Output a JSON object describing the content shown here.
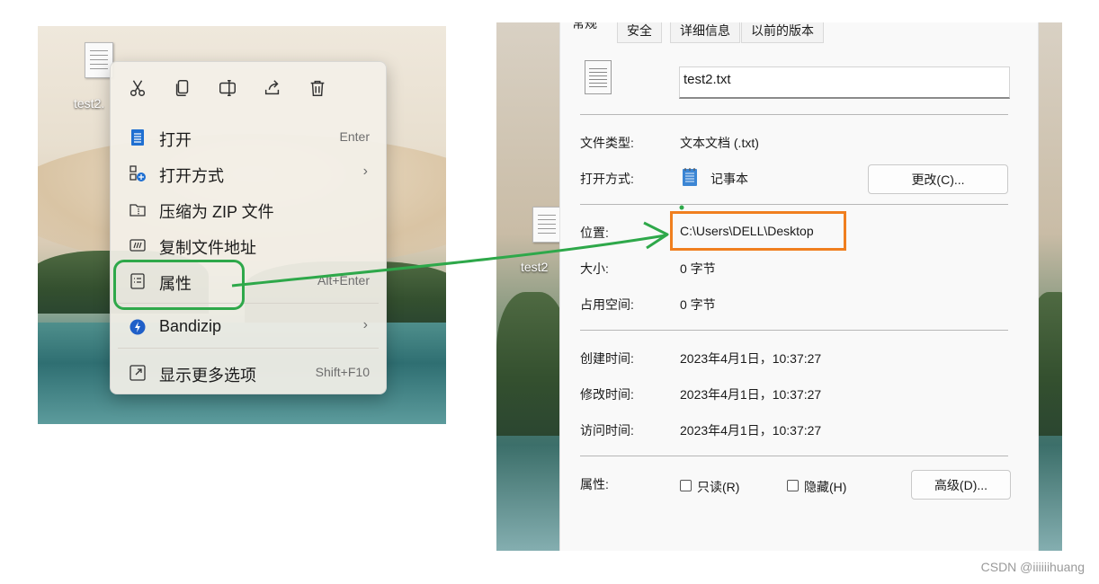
{
  "desktop": {
    "file_label": "test2.",
    "file_label_right": "test2"
  },
  "context_menu": {
    "toolbar": [
      {
        "name": "cut-icon"
      },
      {
        "name": "copy-icon"
      },
      {
        "name": "rename-icon"
      },
      {
        "name": "share-icon"
      },
      {
        "name": "delete-icon"
      }
    ],
    "items": [
      {
        "label": "打开",
        "shortcut": "Enter",
        "icon": "notepad-icon"
      },
      {
        "label": "打开方式",
        "shortcut": "",
        "icon": "open-with-icon",
        "submenu": true
      },
      {
        "label": "压缩为 ZIP 文件",
        "shortcut": "",
        "icon": "zip-icon"
      },
      {
        "label": "复制文件地址",
        "shortcut": "",
        "icon": "copy-path-icon"
      },
      {
        "label": "属性",
        "shortcut": "Alt+Enter",
        "icon": "properties-icon"
      },
      {
        "label": "Bandizip",
        "shortcut": "",
        "icon": "bandizip-icon",
        "submenu": true
      },
      {
        "label": "显示更多选项",
        "shortcut": "Shift+F10",
        "icon": "more-options-icon"
      }
    ],
    "arrow_glyph": "›"
  },
  "properties": {
    "tabs": [
      "常规",
      "安全",
      "详细信息",
      "以前的版本"
    ],
    "file_name": "test2.txt",
    "type_label": "文件类型:",
    "type_value": "文本文档 (.txt)",
    "opens_with_label": "打开方式:",
    "opens_with_value": "记事本",
    "change_button": "更改(C)...",
    "location_label": "位置:",
    "location_value": "C:\\Users\\DELL\\Desktop",
    "size_label": "大小:",
    "size_value": "0 字节",
    "size_on_disk_label": "占用空间:",
    "size_on_disk_value": "0 字节",
    "created_label": "创建时间:",
    "created_value": "2023年4月1日，10:37:27",
    "modified_label": "修改时间:",
    "modified_value": "2023年4月1日，10:37:27",
    "accessed_label": "访问时间:",
    "accessed_value": "2023年4月1日，10:37:27",
    "attributes_label": "属性:",
    "readonly_label": "只读(R)",
    "hidden_label": "隐藏(H)",
    "advanced_button": "高级(D)..."
  },
  "annotation": {
    "highlight_color": "#2ea84a",
    "location_box_color": "#f07f1f"
  },
  "watermark": "CSDN @iiiiiihuang"
}
